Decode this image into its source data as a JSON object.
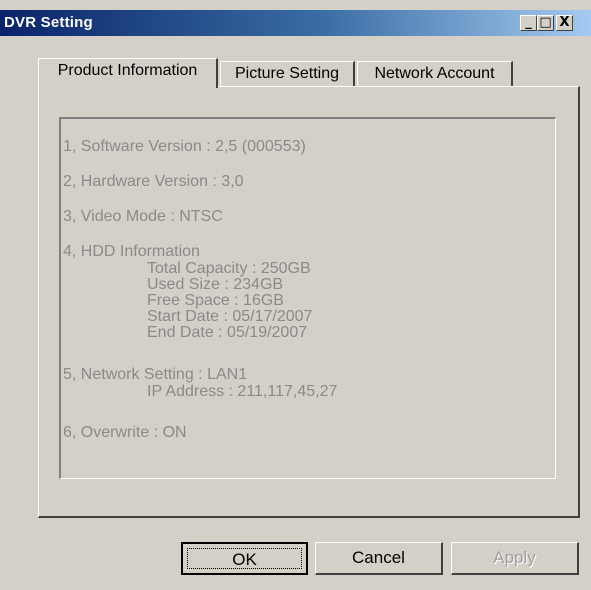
{
  "window": {
    "title": "DVR Setting",
    "controls": {
      "minimize": "_",
      "maximize": "□",
      "close": "X"
    }
  },
  "tabs": [
    {
      "label": "Product Information",
      "active": true
    },
    {
      "label": "Picture Setting",
      "active": false
    },
    {
      "label": "Network Account",
      "active": false
    }
  ],
  "info": {
    "software_version": "1, Software Version : 2,5 (000553)",
    "hardware_version": "2, Hardware Version : 3,0",
    "video_mode": "3, Video Mode : NTSC",
    "hdd_heading": "4, HDD Information",
    "total_capacity": "Total Capacity : 250GB",
    "used_size": "Used Size : 234GB",
    "free_space": "Free Space : 16GB",
    "start_date": "Start Date : 05/17/2007",
    "end_date": "End Date : 05/19/2007",
    "network_setting": "5, Network Setting : LAN1",
    "ip_address": "IP Address : 211,117,45,27",
    "overwrite": "6, Overwrite : ON"
  },
  "buttons": {
    "ok": "OK",
    "cancel": "Cancel",
    "apply": "Apply"
  }
}
